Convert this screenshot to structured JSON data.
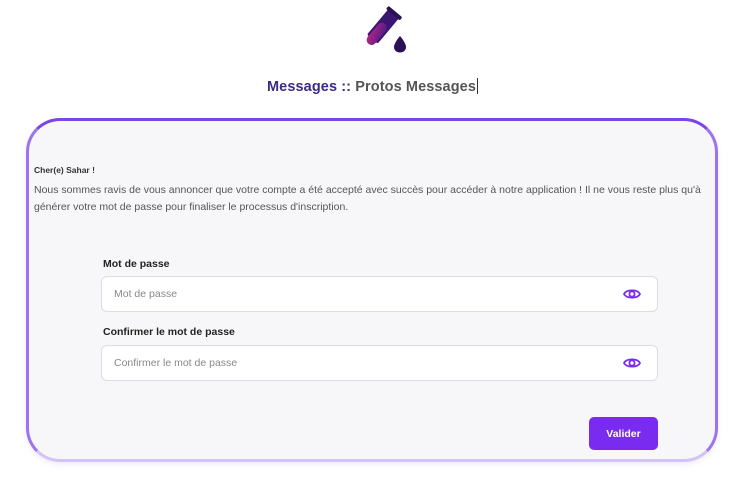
{
  "header": {
    "logo_icon": "test-tube-droplet-icon",
    "title_main": "Messages",
    "title_separator": " :: ",
    "title_sub": "Protos Messages"
  },
  "card": {
    "greeting": "Cher(e) Sahar !",
    "message": "Nous sommes ravis de vous annoncer que votre compte a été accepté avec succès pour accéder à notre application ! Il ne vous reste plus qu'à générer votre mot de passe pour finaliser le processus d'inscription."
  },
  "form": {
    "password": {
      "label": "Mot de passe",
      "placeholder": "Mot de passe",
      "value": "",
      "toggle_icon": "eye-icon"
    },
    "confirm_password": {
      "label": "Confirmer le mot de passe",
      "placeholder": "Confirmer le mot de passe",
      "value": "",
      "toggle_icon": "eye-icon"
    },
    "submit_label": "Valider"
  },
  "colors": {
    "accent": "#7a2bf0",
    "logo_gradient_start": "#b8267e",
    "logo_gradient_end": "#4b1a8c",
    "title_color": "#3b2a86"
  }
}
